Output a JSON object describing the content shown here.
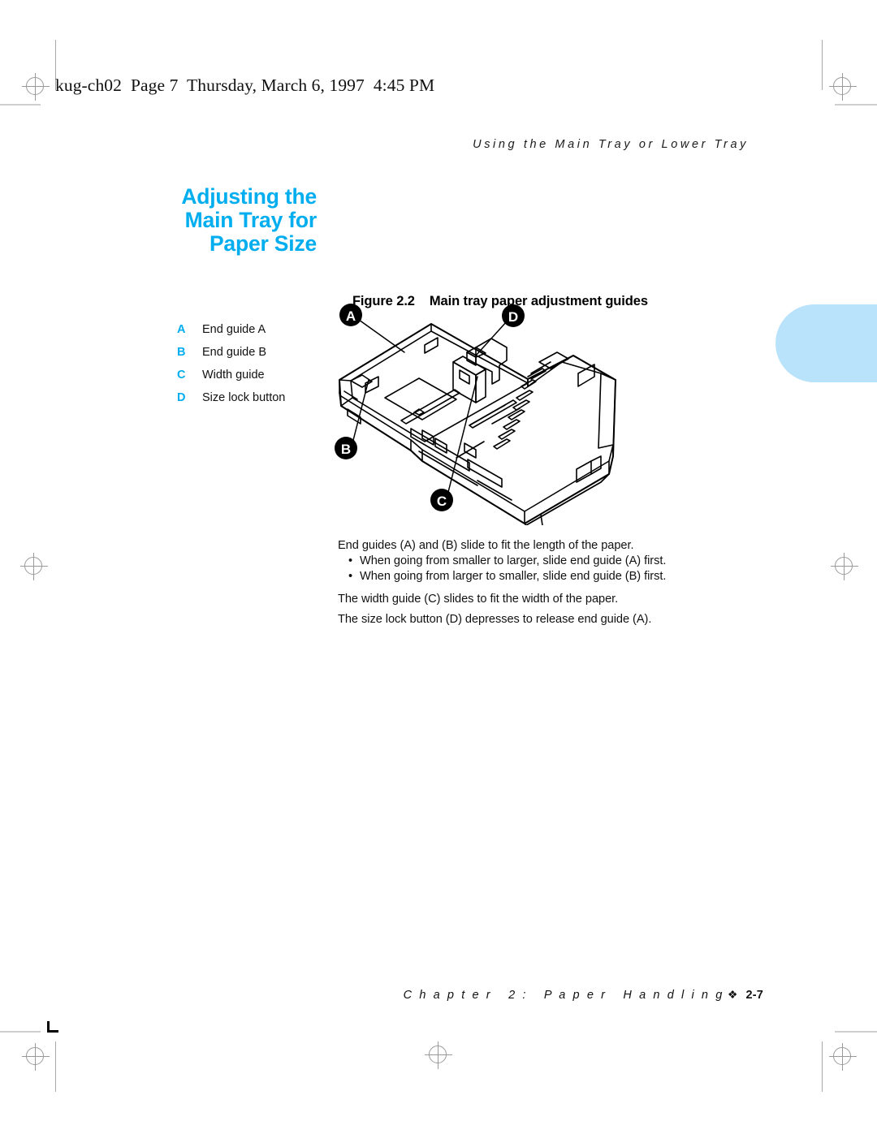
{
  "file_header": "kug-ch02  Page 7  Thursday, March 6, 1997  4:45 PM",
  "running_head": "Using the Main Tray or Lower Tray",
  "section_heading": {
    "line1": "Adjusting the",
    "line2": "Main Tray for",
    "line3": "Paper Size",
    "color": "#00aeef"
  },
  "figure": {
    "caption_number": "Figure 2.2",
    "caption_text": "Main tray paper adjustment guides",
    "callouts": [
      {
        "key": "A"
      },
      {
        "key": "B"
      },
      {
        "key": "C"
      },
      {
        "key": "D"
      }
    ],
    "alt": "Line drawing of printer main paper tray showing end guides, width guide and size lock button"
  },
  "legend": [
    {
      "key": "A",
      "label": "End guide A"
    },
    {
      "key": "B",
      "label": "End guide B"
    },
    {
      "key": "C",
      "label": "Width guide"
    },
    {
      "key": "D",
      "label": "Size lock button"
    }
  ],
  "body": {
    "para1": "End guides (A) and (B) slide to fit the length of the paper.",
    "bullets": [
      "When going from smaller to larger, slide end guide (A) first.",
      "When going from larger to smaller, slide end guide (B) first."
    ],
    "bullet_glyph": "•",
    "para2": "The width guide (C) slides to fit the width of the paper.",
    "para3": "The size lock button (D) depresses to release end guide (A)."
  },
  "footer": {
    "chapter": "C h a p t e r   2 :   P a p e r   H a n d l i n g",
    "ornament": "❖",
    "page_number": "2-7"
  },
  "tab": {
    "color": "#b9e3fa"
  }
}
